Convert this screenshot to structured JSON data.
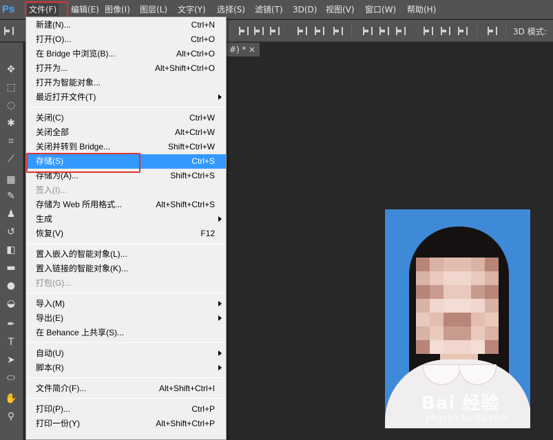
{
  "app": {
    "logo": "Ps"
  },
  "menubar": {
    "items": [
      "文件(F)",
      "编辑(E)",
      "图像(I)",
      "图层(L)",
      "文字(Y)",
      "选择(S)",
      "滤镜(T)",
      "3D(D)",
      "视图(V)",
      "窗口(W)",
      "帮助(H)"
    ]
  },
  "optionsbar": {
    "mode_label": "3D 模式:"
  },
  "document": {
    "tab_label": "#) *",
    "tab_close": "×"
  },
  "file_menu": {
    "items": [
      {
        "label": "新建(N)...",
        "shortcut": "Ctrl+N"
      },
      {
        "label": "打开(O)...",
        "shortcut": "Ctrl+O"
      },
      {
        "label": "在 Bridge 中浏览(B)...",
        "shortcut": "Alt+Ctrl+O"
      },
      {
        "label": "打开为...",
        "shortcut": "Alt+Shift+Ctrl+O"
      },
      {
        "label": "打开为智能对象...",
        "shortcut": ""
      },
      {
        "label": "最近打开文件(T)",
        "shortcut": "",
        "submenu": true
      },
      {
        "label": "关闭(C)",
        "shortcut": "Ctrl+W"
      },
      {
        "label": "关闭全部",
        "shortcut": "Alt+Ctrl+W"
      },
      {
        "label": "关闭并转到 Bridge...",
        "shortcut": "Shift+Ctrl+W"
      },
      {
        "label": "存储(S)",
        "shortcut": "Ctrl+S",
        "selected": true
      },
      {
        "label": "存储为(A)...",
        "shortcut": "Shift+Ctrl+S"
      },
      {
        "label": "签入(I)...",
        "shortcut": "",
        "disabled": true
      },
      {
        "label": "存储为 Web 所用格式...",
        "shortcut": "Alt+Shift+Ctrl+S"
      },
      {
        "label": "生成",
        "shortcut": "",
        "submenu": true
      },
      {
        "label": "恢复(V)",
        "shortcut": "F12"
      },
      {
        "label": "置入嵌入的智能对象(L)...",
        "shortcut": ""
      },
      {
        "label": "置入链接的智能对象(K)...",
        "shortcut": ""
      },
      {
        "label": "打包(G)...",
        "shortcut": "",
        "disabled": true
      },
      {
        "label": "导入(M)",
        "shortcut": "",
        "submenu": true
      },
      {
        "label": "导出(E)",
        "shortcut": "",
        "submenu": true
      },
      {
        "label": "在 Behance 上共享(S)...",
        "shortcut": ""
      },
      {
        "label": "自动(U)",
        "shortcut": "",
        "submenu": true
      },
      {
        "label": "脚本(R)",
        "shortcut": "",
        "submenu": true
      },
      {
        "label": "文件简介(F)...",
        "shortcut": "Alt+Shift+Ctrl+I"
      },
      {
        "label": "打印(P)...",
        "shortcut": "Ctrl+P"
      },
      {
        "label": "打印一份(Y)",
        "shortcut": "Alt+Shift+Ctrl+P"
      }
    ]
  },
  "tools": [
    "move-icon",
    "marquee-icon",
    "lasso-icon",
    "magic-wand-icon",
    "crop-icon",
    "eyedropper-icon",
    "healing-brush-icon",
    "brush-icon",
    "clone-stamp-icon",
    "history-brush-icon",
    "eraser-icon",
    "gradient-icon",
    "blur-icon",
    "dodge-icon",
    "pen-icon",
    "type-icon",
    "path-selection-icon",
    "ellipse-icon",
    "hand-icon",
    "zoom-icon"
  ],
  "watermark": {
    "main": "Bai 经验",
    "sub": "jingyan.baidu.com"
  },
  "colors": {
    "menu_selected": "#3399ff",
    "highlight_box": "#e03030",
    "photo_bg": "#3e8ad8"
  }
}
